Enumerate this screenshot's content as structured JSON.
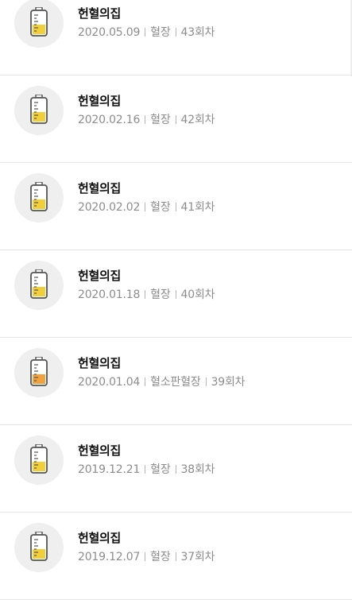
{
  "records": [
    {
      "title": "헌혈의집",
      "date": "2020.05.09",
      "type": "혈장",
      "count": "43회차",
      "fill_color": "#f2cf3a",
      "fill_level": 0.55
    },
    {
      "title": "헌혈의집",
      "date": "2020.02.16",
      "type": "혈장",
      "count": "42회차",
      "fill_color": "#f2cf3a",
      "fill_level": 0.55
    },
    {
      "title": "헌혈의집",
      "date": "2020.02.02",
      "type": "혈장",
      "count": "41회차",
      "fill_color": "#f2cf3a",
      "fill_level": 0.55
    },
    {
      "title": "헌혈의집",
      "date": "2020.01.18",
      "type": "혈장",
      "count": "40회차",
      "fill_color": "#f2cf3a",
      "fill_level": 0.55
    },
    {
      "title": "헌혈의집",
      "date": "2020.01.04",
      "type": "혈소판혈장",
      "count": "39회차",
      "fill_color": "#f2a13f",
      "fill_level": 0.55
    },
    {
      "title": "헌혈의집",
      "date": "2019.12.21",
      "type": "혈장",
      "count": "38회차",
      "fill_color": "#f2cf3a",
      "fill_level": 0.55
    },
    {
      "title": "헌혈의집",
      "date": "2019.12.07",
      "type": "혈장",
      "count": "37회차",
      "fill_color": "#f2cf3a",
      "fill_level": 0.55
    }
  ],
  "icon": "blood-bag-icon"
}
